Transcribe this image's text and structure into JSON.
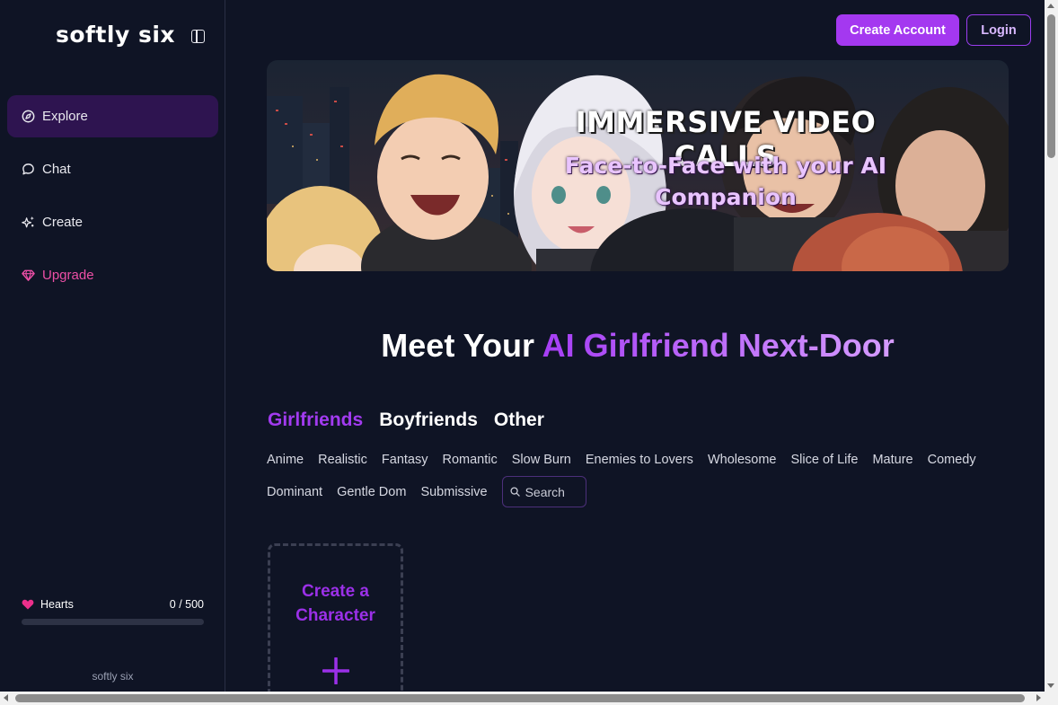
{
  "sidebar": {
    "brand": "softly six",
    "toggle_icon": "sidebar-toggle-icon",
    "items": [
      {
        "label": "Explore",
        "icon": "compass-icon",
        "active": true
      },
      {
        "label": "Chat",
        "icon": "chat-bubble-icon",
        "active": false
      },
      {
        "label": "Create",
        "icon": "sparkles-icon",
        "active": false
      },
      {
        "label": "Upgrade",
        "icon": "gem-icon",
        "active": false
      }
    ],
    "hearts": {
      "label": "Hearts",
      "value": "0 / 500",
      "fill_fraction": 0
    },
    "footer": "softly six"
  },
  "header": {
    "create_account": "Create Account",
    "login": "Login"
  },
  "banner": {
    "title": "IMMERSIVE VIDEO CALLS",
    "subtitle": "Face-to-Face with your AI Companion"
  },
  "headline": {
    "prefix": "Meet Your ",
    "accent": "AI Girlfriend Next-Door"
  },
  "tabs": [
    "Girlfriends",
    "Boyfriends",
    "Other"
  ],
  "active_tab": "Girlfriends",
  "tags": [
    "Anime",
    "Realistic",
    "Fantasy",
    "Romantic",
    "Slow Burn",
    "Enemies to Lovers",
    "Wholesome",
    "Slice of Life",
    "Mature",
    "Comedy",
    "Dominant",
    "Gentle Dom",
    "Submissive"
  ],
  "search": {
    "placeholder": "Search"
  },
  "create_card": {
    "title": "Create a Character"
  },
  "colors": {
    "background": "#0f1425",
    "accent": "#a438f0",
    "active_nav": "#2e1450",
    "upgrade": "#ec4fa6"
  }
}
